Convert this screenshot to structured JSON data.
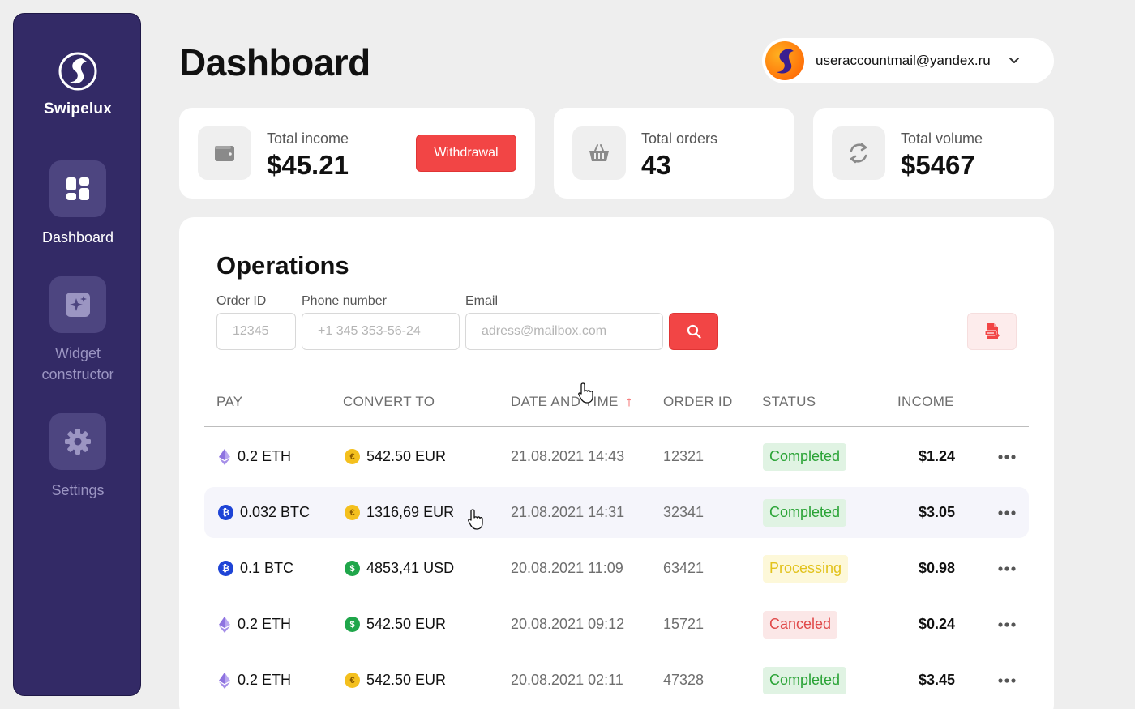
{
  "brand": {
    "name": "Swipelux"
  },
  "sidebar": {
    "items": [
      {
        "label": "Dashboard",
        "icon": "dashboard-icon",
        "active": true
      },
      {
        "label": "Widget constructor",
        "icon": "widget-icon",
        "active": false
      },
      {
        "label": "Settings",
        "icon": "gear-icon",
        "active": false
      }
    ]
  },
  "header": {
    "title": "Dashboard",
    "account_email": "useraccountmail@yandex.ru"
  },
  "stats": {
    "income": {
      "label": "Total income",
      "value": "$45.21",
      "button": "Withdrawal"
    },
    "orders": {
      "label": "Total orders",
      "value": "43"
    },
    "volume": {
      "label": "Total volume",
      "value": "$5467"
    }
  },
  "operations": {
    "title": "Operations",
    "filters": {
      "order_id": {
        "label": "Order ID",
        "placeholder": "12345"
      },
      "phone": {
        "label": "Phone number",
        "placeholder": "+1 345 353-56-24"
      },
      "email": {
        "label": "Email",
        "placeholder": "adress@mailbox.com"
      }
    },
    "columns": {
      "pay": "PAY",
      "convert": "CONVERT TO",
      "date": "DATE AND TIME",
      "sort_arrow": "↑",
      "order": "ORDER ID",
      "status": "STATUS",
      "income": "INCOME"
    },
    "rows": [
      {
        "pay": "0.2 ETH",
        "pay_coin": "eth",
        "convert": "542.50 EUR",
        "convert_coin": "eur",
        "date": "21.08.2021 14:43",
        "order": "12321",
        "status": "Completed",
        "status_type": "completed",
        "income": "$1.24"
      },
      {
        "pay": "0.032 BTC",
        "pay_coin": "btc",
        "convert": "1316,69 EUR",
        "convert_coin": "eur",
        "date": "21.08.2021 14:31",
        "order": "32341",
        "status": "Completed",
        "status_type": "completed",
        "income": "$3.05"
      },
      {
        "pay": "0.1 BTC",
        "pay_coin": "btc",
        "convert": "4853,41 USD",
        "convert_coin": "usd",
        "date": "20.08.2021 11:09",
        "order": "63421",
        "status": "Processing",
        "status_type": "processing",
        "income": "$0.98"
      },
      {
        "pay": "0.2 ETH",
        "pay_coin": "eth",
        "convert": "542.50 EUR",
        "convert_coin": "usd",
        "date": "20.08.2021 09:12",
        "order": "15721",
        "status": "Canceled",
        "status_type": "canceled",
        "income": "$0.24"
      },
      {
        "pay": "0.2 ETH",
        "pay_coin": "eth",
        "convert": "542.50 EUR",
        "convert_coin": "eur",
        "date": "20.08.2021 02:11",
        "order": "47328",
        "status": "Completed",
        "status_type": "completed",
        "income": "$3.45"
      }
    ],
    "highlighted_row": 1
  },
  "colors": {
    "sidebar": "#332a66",
    "accent": "#f24545",
    "completed": "#2aa336",
    "processing": "#e2c21c",
    "canceled": "#e04a4a"
  }
}
